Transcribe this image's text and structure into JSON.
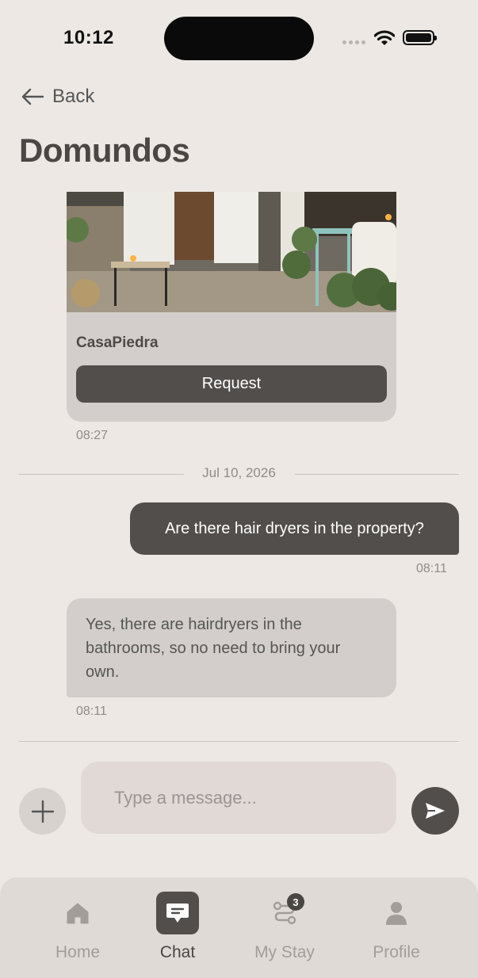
{
  "status_bar": {
    "time": "10:12"
  },
  "nav": {
    "back_label": "Back",
    "title": "Domundos"
  },
  "listing_card": {
    "name": "CasaPiedra",
    "button_label": "Request",
    "timestamp": "08:27"
  },
  "date_separator": "Jul 10, 2026",
  "messages": [
    {
      "direction": "outgoing",
      "text": "Are there hair dryers in the property?",
      "time": "08:11"
    },
    {
      "direction": "incoming",
      "text": "Yes, there are hairdryers in the bathrooms, so no need to bring your own.",
      "time": "08:11"
    }
  ],
  "composer": {
    "placeholder": "Type a message..."
  },
  "tabbar": {
    "items": [
      {
        "label": "Home",
        "icon": "home-icon",
        "active": false
      },
      {
        "label": "Chat",
        "icon": "chat-icon",
        "active": true
      },
      {
        "label": "My Stay",
        "icon": "route-icon",
        "active": false,
        "badge": "3"
      },
      {
        "label": "Profile",
        "icon": "person-icon",
        "active": false
      }
    ]
  },
  "colors": {
    "background": "#ede8e3",
    "accent": "#524e4b",
    "bubble_in": "#d3cecb",
    "tabbar": "#e0dad6"
  }
}
